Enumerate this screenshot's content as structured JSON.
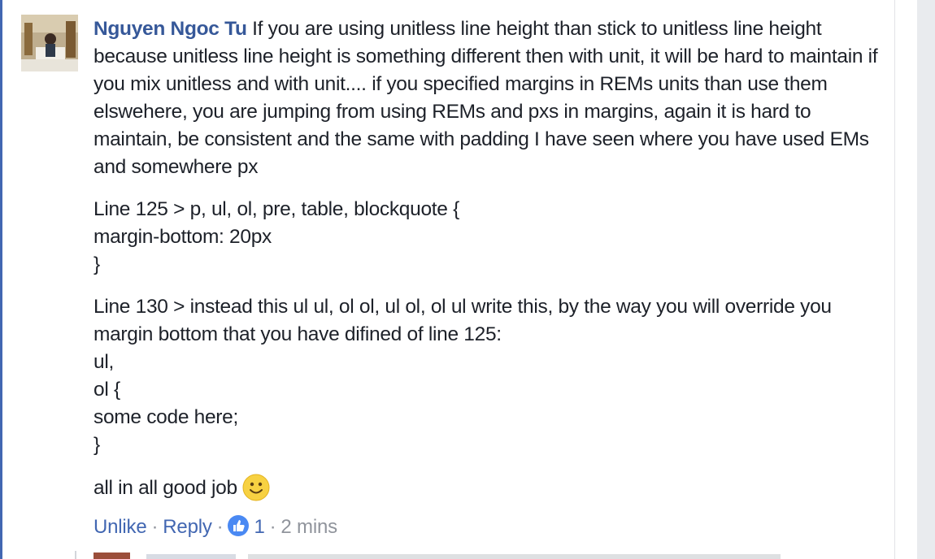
{
  "comment": {
    "author": "Nguyen Ngoc Tu",
    "paragraphs": [
      [
        "If you are using unitless line height than stick to unitless line height because unitless line height is something different then with unit, it will be hard to maintain if you mix unitless and with unit.... if you specified margins in REMs units than use them elswehere, you are jumping from using REMs and pxs in margins, again it is hard to maintain, be consistent and the same with padding I have seen where you have used EMs and somewhere px"
      ],
      [
        "Line 125 > p, ul, ol, pre, table, blockquote {",
        "margin-bottom: 20px",
        "}"
      ],
      [
        "Line 130 > instead this ul ul, ol ol, ul ol, ol ul write this, by the way you will override you margin bottom that you have difined of line 125:",
        "ul,",
        "ol {",
        "some code here;",
        "}"
      ],
      [
        "all in all good job"
      ]
    ],
    "emoji": "slightly-smiling-face-emoji"
  },
  "actions": {
    "unlike": "Unlike",
    "separator": "·",
    "reply": "Reply",
    "like_icon": "thumbs-up-icon",
    "like_count": "1",
    "timestamp": "2 mins"
  },
  "colors": {
    "author": "#365899",
    "link": "#4267b2",
    "muted": "#90949c",
    "like_badge": "#4a89f3",
    "left_bar": "#4267b2"
  }
}
